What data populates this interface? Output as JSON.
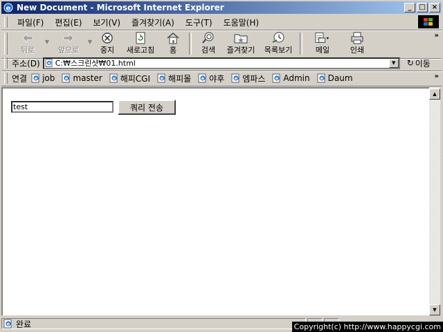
{
  "window": {
    "title": "New Document - Microsoft Internet Explorer",
    "controls": [
      "_",
      "□",
      "×"
    ]
  },
  "menu": [
    "파일(F)",
    "편집(E)",
    "보기(V)",
    "즐겨찾기(A)",
    "도구(T)",
    "도움말(H)"
  ],
  "toolbar": {
    "back": "뒤로",
    "forward": "앞으로",
    "stop": "중지",
    "refresh": "새로고침",
    "home": "홈",
    "search": "검색",
    "favorites": "즐겨찾기",
    "history": "목록보기",
    "mail": "메일",
    "print": "인쇄",
    "more": "»"
  },
  "address": {
    "label": "주소(D)",
    "url": "C:₩스크린샷₩01.html",
    "go": "이동"
  },
  "links": {
    "label": "연결",
    "items": [
      "job",
      "master",
      "해피CGI",
      "해피몰",
      "야후",
      "엠파스",
      "Admin",
      "Daum"
    ],
    "more": "»"
  },
  "form": {
    "input_value": "test",
    "submit_label": "쿼리 전송"
  },
  "status": {
    "text": "완료",
    "copyright": "Copyright(c) http://www.happycgi.com"
  },
  "colors": {
    "titlebar_start": "#0a246a",
    "titlebar_end": "#a6caf0",
    "chrome": "#d4d0c8"
  }
}
